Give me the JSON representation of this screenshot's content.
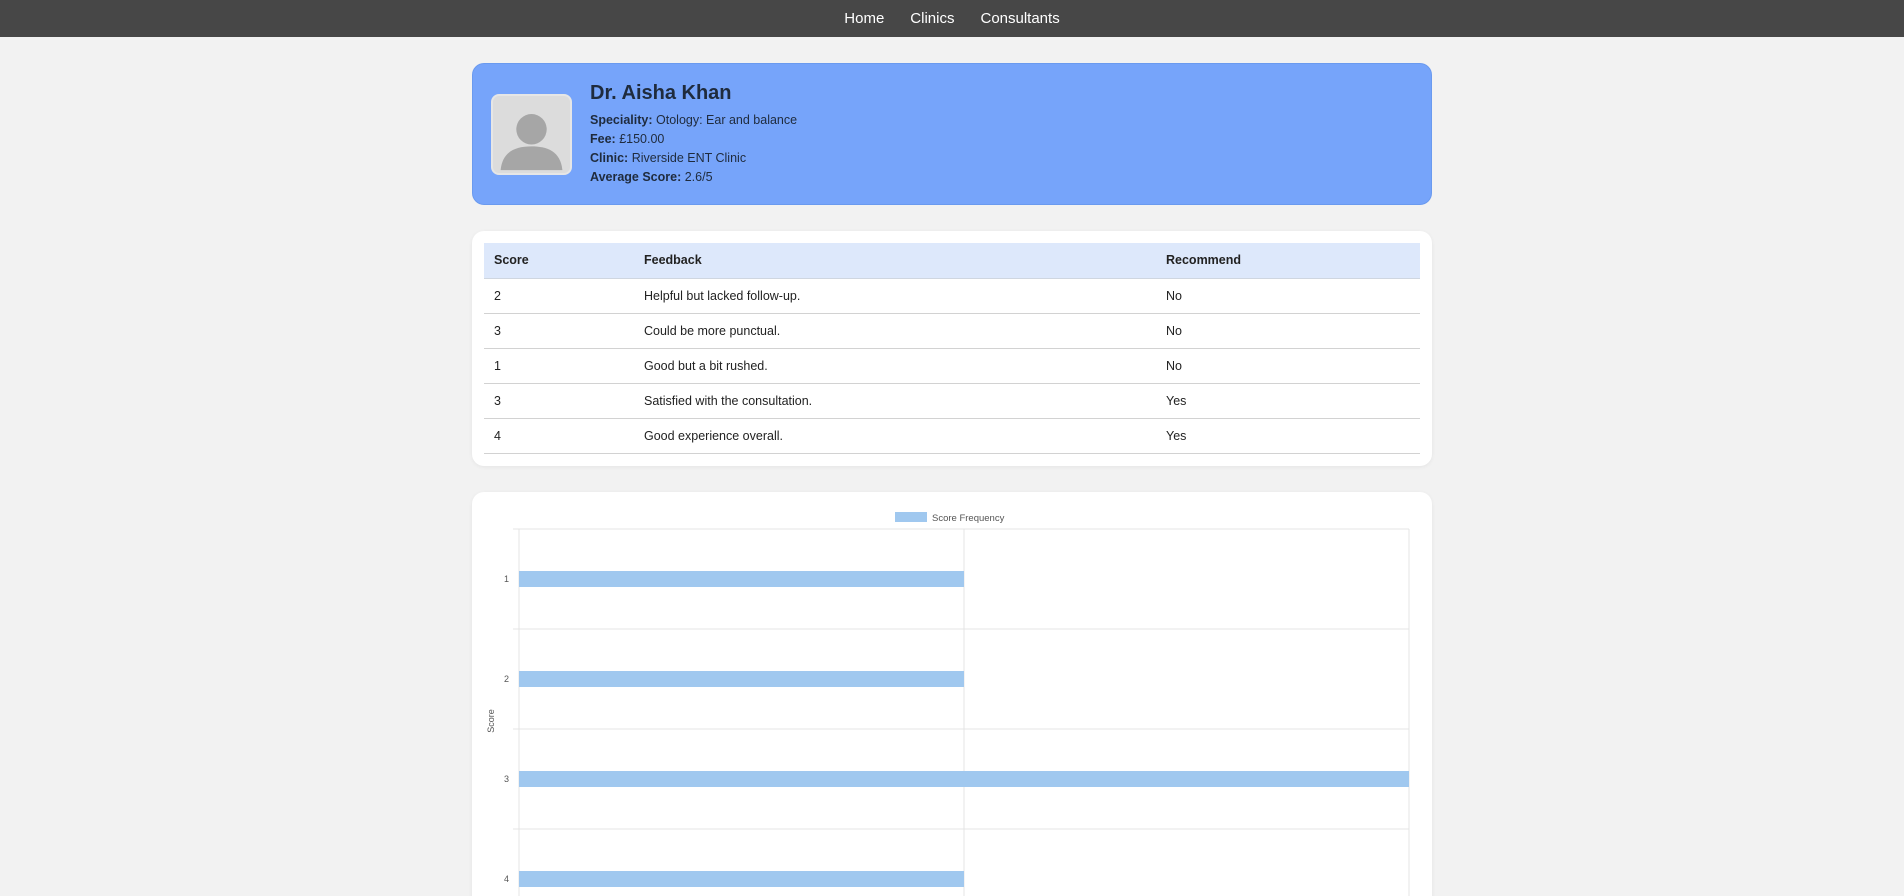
{
  "nav": {
    "items": [
      "Home",
      "Clinics",
      "Consultants"
    ]
  },
  "profile": {
    "name": "Dr. Aisha Khan",
    "speciality_label": "Speciality:",
    "speciality": "Otology: Ear and balance",
    "fee_label": "Fee:",
    "fee": "£150.00",
    "clinic_label": "Clinic:",
    "clinic": "Riverside ENT Clinic",
    "avg_label": "Average Score:",
    "avg": "2.6/5",
    "avatar_icon": "person-avatar-icon"
  },
  "reviews": {
    "headers": [
      "Score",
      "Feedback",
      "Recommend"
    ],
    "rows": [
      [
        "2",
        "Helpful but lacked follow-up.",
        "No"
      ],
      [
        "3",
        "Could be more punctual.",
        "No"
      ],
      [
        "1",
        "Good but a bit rushed.",
        "No"
      ],
      [
        "3",
        "Satisfied with the consultation.",
        "Yes"
      ],
      [
        "4",
        "Good experience overall.",
        "Yes"
      ]
    ]
  },
  "colors": {
    "nav_bg": "#474747",
    "profile_bg": "#76a4fa",
    "table_header_bg": "#dde8fb",
    "bar_fill": "#a0c8ef"
  },
  "chart_data": {
    "type": "bar",
    "orientation": "horizontal",
    "categories": [
      "1",
      "2",
      "3",
      "4"
    ],
    "series": [
      {
        "name": "Score Frequency",
        "values": [
          1,
          1,
          2,
          1
        ]
      }
    ],
    "xlabel": "",
    "ylabel": "Score",
    "xlim": [
      0,
      2
    ],
    "legend": "top-center",
    "grid": true
  }
}
